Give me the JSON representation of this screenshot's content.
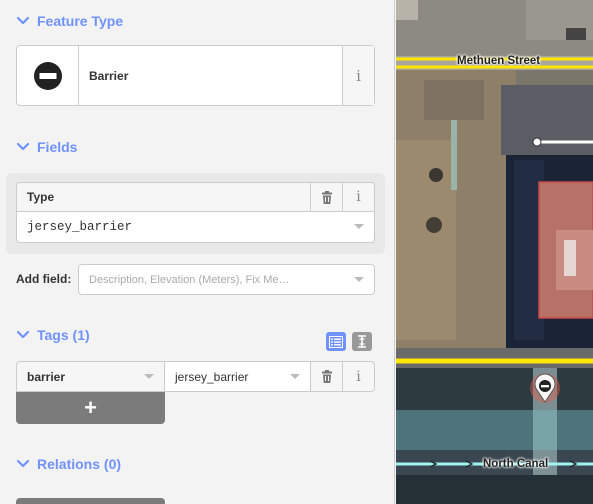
{
  "inspector": {
    "feature_type": {
      "heading": "Feature Type",
      "preset_name": "Barrier",
      "preset_icon": "barrier-icon"
    },
    "fields": {
      "heading": "Fields",
      "type_field": {
        "label": "Type",
        "value": "jersey_barrier"
      },
      "add_field": {
        "label": "Add field:",
        "placeholder": "Description, Elevation (Meters), Fix Me…"
      }
    },
    "tags": {
      "heading": "Tags (1)",
      "rows": [
        {
          "key": "barrier",
          "value": "jersey_barrier"
        }
      ],
      "add_label": "+"
    },
    "relations": {
      "heading": "Relations (0)"
    },
    "info_glyph": "i"
  },
  "map": {
    "labels": {
      "street_top": "Methuen Street",
      "street_bottom": "North Canal"
    }
  },
  "colors": {
    "accent": "#7092ff",
    "highlight_road": "#ffe600",
    "canal": "#9ff5f0",
    "selected_marker": "#333333"
  }
}
